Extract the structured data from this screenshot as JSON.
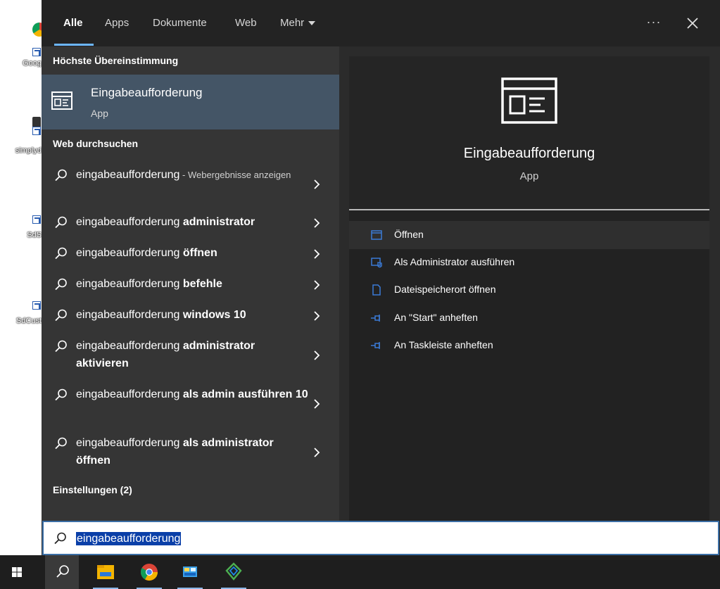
{
  "desktop": {
    "icons": [
      {
        "label": "Goog",
        "icon": "chrome-shortcut-icon"
      },
      {
        "label": "simplyd",
        "icon": "app-shortcut-icon"
      },
      {
        "label": "SdS",
        "icon": "app-shortcut-icon"
      },
      {
        "label": "SdCust",
        "icon": "app-shortcut-icon"
      }
    ]
  },
  "tabs": [
    {
      "label": "Alle",
      "active": true
    },
    {
      "label": "Apps"
    },
    {
      "label": "Dokumente"
    },
    {
      "label": "Web"
    },
    {
      "label": "Mehr"
    }
  ],
  "header": {
    "more_label": "···",
    "close_icon": "close-icon"
  },
  "results": {
    "best_match_heading": "Höchste Übereinstimmung",
    "best_match": {
      "name": "Eingabeaufforderung",
      "type": "App"
    },
    "web_heading": "Web durchsuchen",
    "web_items": [
      {
        "base": "eingabeaufforderung",
        "bold": "",
        "suffix": " - Webergebnisse anzeigen"
      },
      {
        "base": "eingabeaufforderung ",
        "bold": "administrator",
        "suffix": ""
      },
      {
        "base": "eingabeaufforderung ",
        "bold": "öffnen",
        "suffix": ""
      },
      {
        "base": "eingabeaufforderung ",
        "bold": "befehle",
        "suffix": ""
      },
      {
        "base": "eingabeaufforderung ",
        "bold": "windows 10",
        "suffix": ""
      },
      {
        "base": "eingabeaufforderung ",
        "bold": "administrator aktivieren",
        "suffix": ""
      },
      {
        "base": "eingabeaufforderung ",
        "bold": "als admin ausführen 10",
        "suffix": ""
      },
      {
        "base": "eingabeaufforderung ",
        "bold": "als administrator öffnen",
        "suffix": ""
      }
    ],
    "settings_heading": "Einstellungen (2)"
  },
  "preview": {
    "name": "Eingabeaufforderung",
    "type": "App",
    "actions": [
      {
        "label": "Öffnen",
        "icon": "open-icon"
      },
      {
        "label": "Als Administrator ausführen",
        "icon": "run-as-admin-icon"
      },
      {
        "label": "Dateispeicherort öffnen",
        "icon": "file-location-icon"
      },
      {
        "label": "An \"Start\" anheften",
        "icon": "pin-icon"
      },
      {
        "label": "An Taskleiste anheften",
        "icon": "pin-icon"
      }
    ]
  },
  "search": {
    "query": "eingabeaufforderung"
  },
  "taskbar": {
    "items": [
      "windows-start-icon",
      "search-icon",
      "file-explorer-icon",
      "chrome-icon",
      "control-panel-icon",
      "app-icon"
    ]
  },
  "colors": {
    "panel_bg": "#2b2b2b",
    "list_bg": "#353535",
    "selected_bg": "#445566",
    "accent": "#6cb6ff",
    "selection_highlight": "#0a3fa8"
  }
}
